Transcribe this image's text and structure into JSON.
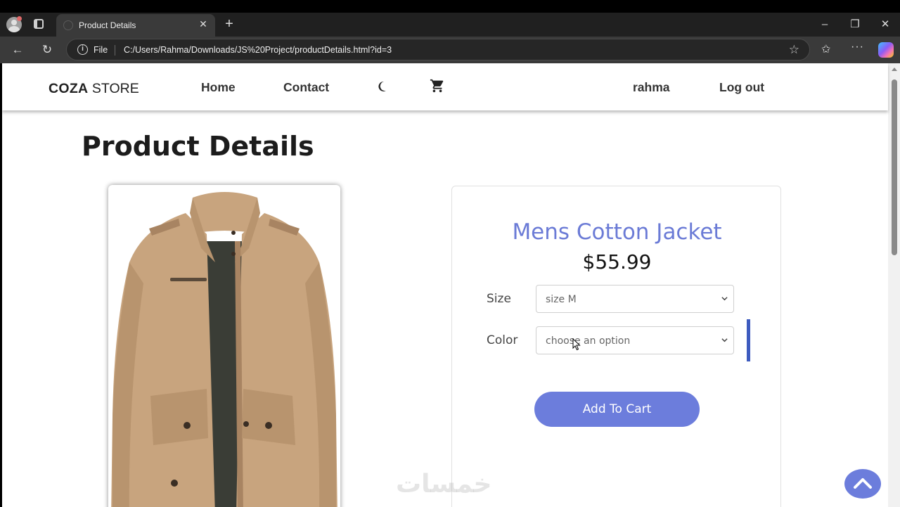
{
  "browser": {
    "tab_title": "Product Details",
    "file_label": "File",
    "url": "C:/Users/Rahma/Downloads/JS%20Project/productDetails.html?id=3"
  },
  "header": {
    "logo_bold": "COZA",
    "logo_light": "STORE",
    "nav": {
      "home": "Home",
      "contact": "Contact",
      "username": "rahma",
      "logout": "Log out"
    }
  },
  "page": {
    "title": "Product Details"
  },
  "product": {
    "name": "Mens Cotton Jacket",
    "price": "$55.99",
    "size_label": "Size",
    "size_value": "size M",
    "color_label": "Color",
    "color_value": "choose an option",
    "add_to_cart": "Add To Cart"
  },
  "watermark": "خمسات",
  "colors": {
    "accent": "#6c7ddc",
    "product_name": "#6b7bd6",
    "accent_bar": "#3d5bbf",
    "jacket": "#c8a47e"
  },
  "icons": {
    "moon": "moon-icon",
    "cart": "cart-icon",
    "scroll_top": "chevron-up-icon"
  }
}
